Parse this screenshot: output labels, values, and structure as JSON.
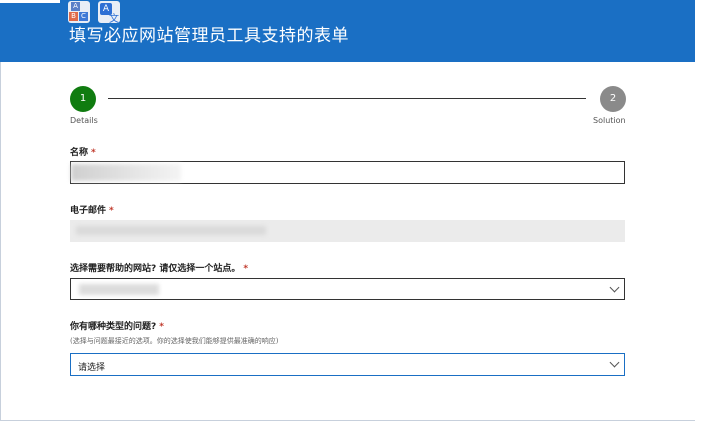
{
  "header": {
    "title": "填写必应网站管理员工具支持的表单",
    "toolbar_icons": [
      "translate-languages-icon",
      "translate-icon"
    ],
    "background_color": "#1a6fc4"
  },
  "steps": [
    {
      "number": "1",
      "label": "Details",
      "state": "active",
      "color": "#107c10"
    },
    {
      "number": "2",
      "label": "Solution",
      "state": "pending",
      "color": "#8a8a8a"
    }
  ],
  "form": {
    "name": {
      "label": "名称",
      "required_mark": "*"
    },
    "email": {
      "label": "电子邮件",
      "required_mark": "*"
    },
    "site": {
      "label": "选择需要帮助的网站? 请仅选择一个站点。",
      "required_mark": "*"
    },
    "issue_type": {
      "label": "你有哪种类型的问题?",
      "required_mark": "*",
      "hint": "(选择与问题最接近的选项。你的选择使我们能够提供最准确的响应)",
      "selected_value": "请选择"
    }
  }
}
